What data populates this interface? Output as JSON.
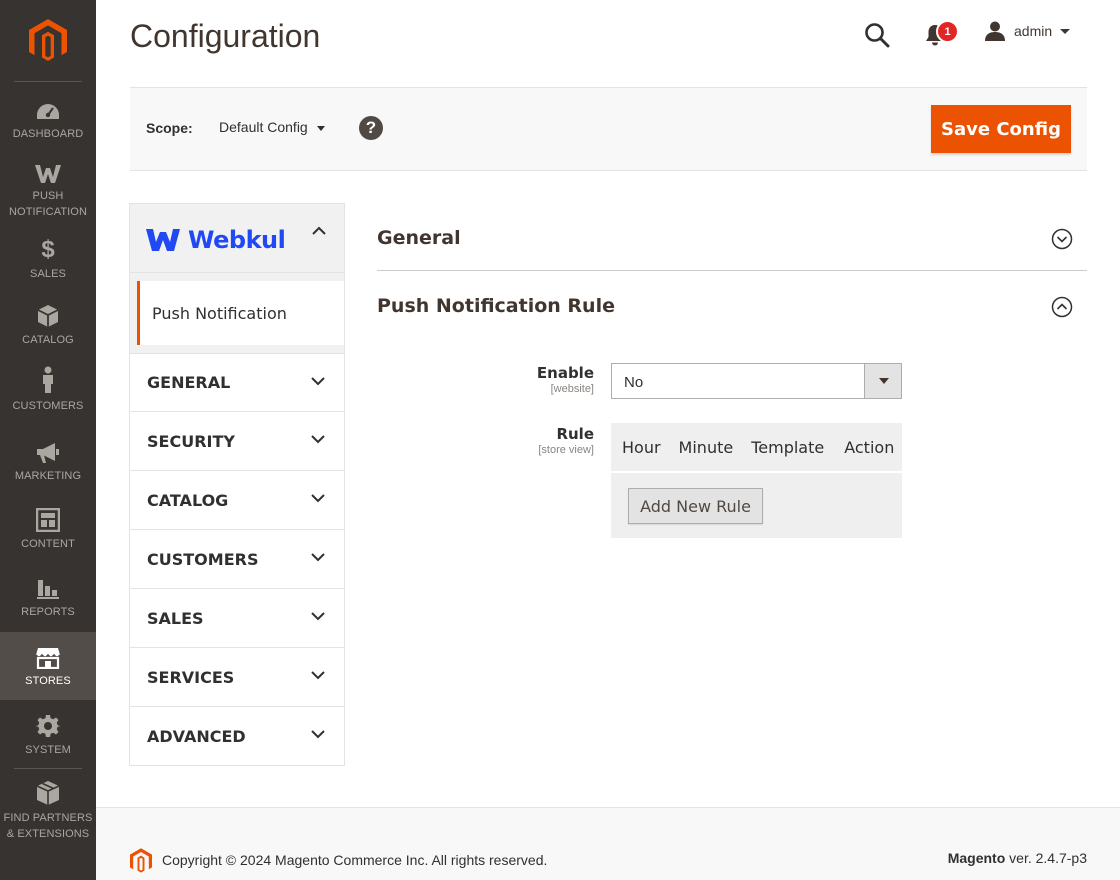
{
  "colors": {
    "sidebar": "#373330",
    "accent": "#eb5202",
    "brand_webkul": "#2149f3"
  },
  "sidebar": {
    "items": [
      {
        "label": "DASHBOARD",
        "icon": "dashboard-icon"
      },
      {
        "label": "PUSH NOTIFICATION",
        "icon": "webkul-w-icon"
      },
      {
        "label": "SALES",
        "icon": "dollar-icon"
      },
      {
        "label": "CATALOG",
        "icon": "box-icon"
      },
      {
        "label": "CUSTOMERS",
        "icon": "person-icon"
      },
      {
        "label": "MARKETING",
        "icon": "megaphone-icon"
      },
      {
        "label": "CONTENT",
        "icon": "content-icon"
      },
      {
        "label": "REPORTS",
        "icon": "bar-chart-icon"
      },
      {
        "label": "STORES",
        "icon": "store-icon",
        "active": true
      },
      {
        "label": "SYSTEM",
        "icon": "gear-icon"
      },
      {
        "label": "FIND PARTNERS & EXTENSIONS",
        "icon": "extensions-icon"
      }
    ]
  },
  "header": {
    "title": "Configuration",
    "notification_count": "1",
    "user": "admin"
  },
  "scope": {
    "label": "Scope:",
    "value": "Default Config",
    "help": "?",
    "save_label": "Save Config"
  },
  "tabs": {
    "group": "Webkul",
    "group_sub": "Push Notification",
    "items": [
      "GENERAL",
      "SECURITY",
      "CATALOG",
      "CUSTOMERS",
      "SALES",
      "SERVICES",
      "ADVANCED"
    ]
  },
  "sections": {
    "general": "General",
    "rule": "Push Notification Rule"
  },
  "fields": {
    "enable": {
      "label": "Enable",
      "scope": "[website]",
      "value": "No"
    },
    "rule": {
      "label": "Rule",
      "scope": "[store view]",
      "columns": [
        "Hour",
        "Minute",
        "Template",
        "Action"
      ],
      "add_label": "Add New Rule"
    }
  },
  "footer": {
    "copyright": "Copyright © 2024 Magento Commerce Inc. All rights reserved.",
    "brand": "Magento",
    "version": " ver. 2.4.7-p3"
  }
}
